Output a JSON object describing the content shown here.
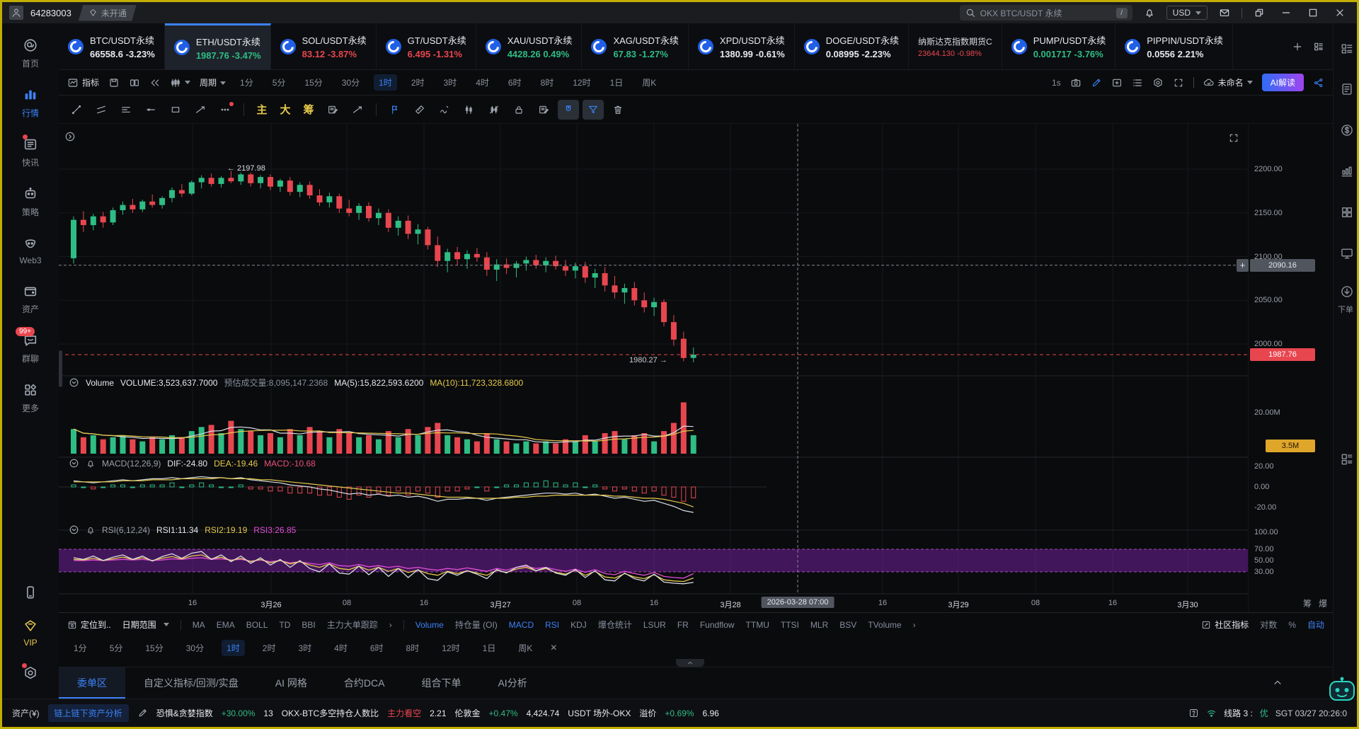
{
  "colors": {
    "up": "#2ebd85",
    "down": "#e8464f",
    "accent": "#3b82f6",
    "yellow": "#e6c94c",
    "magenta": "#e24fd8",
    "white": "#e6e9ef",
    "grey": "#848e9c",
    "orange": "#e0a62a"
  },
  "window": {
    "user_id": "64283003",
    "badge": "未开通",
    "search_placeholder": "OKX BTC/USDT 永续",
    "search_key": "/",
    "currency": "USD"
  },
  "tickers": [
    {
      "sym": "BTC/USDT永续",
      "price": "66558.6",
      "change": "-3.23%",
      "trend": "white"
    },
    {
      "sym": "ETH/USDT永续",
      "price": "1987.76",
      "change": "-3.47%",
      "trend": "green",
      "active": true
    },
    {
      "sym": "SOL/USDT永续",
      "price": "83.12",
      "change": "-3.87%",
      "trend": "red"
    },
    {
      "sym": "GT/USDT永续",
      "price": "6.495",
      "change": "-1.31%",
      "trend": "red"
    },
    {
      "sym": "XAU/USDT永续",
      "price": "4428.26",
      "change": "0.49%",
      "trend": "green"
    },
    {
      "sym": "XAG/USDT永续",
      "price": "67.83",
      "change": "-1.27%",
      "trend": "green"
    },
    {
      "sym": "XPD/USDT永续",
      "price": "1380.99",
      "change": "-0.61%",
      "trend": "white"
    },
    {
      "sym": "DOGE/USDT永续",
      "price": "0.08995",
      "change": "-2.23%",
      "trend": "white"
    },
    {
      "sym": "纳斯达克指数期货C",
      "price": "23644.130",
      "change": "-0.98%",
      "trend": "red",
      "small": true
    },
    {
      "sym": "PUMP/USDT永续",
      "price": "0.001717",
      "change": "-3.76%",
      "trend": "green"
    },
    {
      "sym": "PIPPIN/USDT永续",
      "price": "0.0556",
      "change": "2.21%",
      "trend": "white"
    }
  ],
  "periods": [
    "1分",
    "5分",
    "15分",
    "30分",
    "1时",
    "2时",
    "3时",
    "4时",
    "6时",
    "8时",
    "12时",
    "1日",
    "周K"
  ],
  "toolbar": {
    "indicator_label": "指标",
    "period_label": "周期",
    "active_period": "1时",
    "timer": "1s",
    "layout_name": "未命名",
    "ai_button": "AI解读"
  },
  "draw_toolbar": {
    "glyphs": [
      "主",
      "大",
      "筹"
    ]
  },
  "sidebar": {
    "items": [
      {
        "label": "首页",
        "icon": "home"
      },
      {
        "label": "行情",
        "icon": "bars",
        "active": true
      },
      {
        "label": "快讯",
        "icon": "news",
        "dot": true
      },
      {
        "label": "策略",
        "icon": "robot-head"
      },
      {
        "label": "Web3",
        "icon": "web3"
      },
      {
        "label": "资产",
        "icon": "wallet"
      },
      {
        "label": "群聊",
        "icon": "chat",
        "badge": "99+"
      },
      {
        "label": "更多",
        "icon": "more-grid"
      },
      {
        "label": "",
        "icon": "phone",
        "group": "bottom"
      },
      {
        "label": "VIP",
        "icon": "vip",
        "vip": true,
        "group": "bottom"
      },
      {
        "label": "",
        "icon": "gear-hex",
        "dot": true,
        "group": "bottom"
      }
    ]
  },
  "right_rail": {
    "order_label": "下单"
  },
  "chart": {
    "legend_volume": [
      {
        "t": "Volume",
        "c": "#e6e9ef"
      },
      {
        "t": "VOLUME:3,523,637.7000",
        "c": "#e6e9ef"
      },
      {
        "t": "预估成交量:8,095,147.2368",
        "c": "#848e9c"
      },
      {
        "t": "MA(5):15,822,593.6200",
        "c": "#e6e9ef"
      },
      {
        "t": "MA(10):11,723,328.6800",
        "c": "#e6c94c"
      }
    ],
    "legend_macd": [
      {
        "t": "MACD(12,26,9)",
        "c": "#9aa0aa"
      },
      {
        "t": "DIF:-24.80",
        "c": "#e6e9ef"
      },
      {
        "t": "DEA:-19.46",
        "c": "#e6c94c"
      },
      {
        "t": "MACD:-10.68",
        "c": "#e8507a"
      }
    ],
    "legend_rsi": [
      {
        "t": "RSI(6,12,24)",
        "c": "#9aa0aa"
      },
      {
        "t": "RSI1:11.34",
        "c": "#e6e9ef"
      },
      {
        "t": "RSI2:19.19",
        "c": "#e6c94c"
      },
      {
        "t": "RSI3:26.85",
        "c": "#e24fd8"
      }
    ],
    "annotations": {
      "high": "← 2197.98",
      "low": "1980.27",
      "last_price": "1987.76",
      "crosshair_price": "2090.16",
      "crosshair_time": "2026-03-28 07:00"
    },
    "y_axis_price": [
      "2200.00",
      "2150.00",
      "2100.00",
      "2050.00",
      "2000.00"
    ],
    "y_axis_volume": "20.00M",
    "volume_badge": "3.5M",
    "y_axis_macd": [
      "20.00",
      "0.00",
      "-20.00"
    ],
    "y_axis_rsi": [
      "100.00",
      "70.00",
      "50.00",
      "30.00"
    ],
    "x_axis": [
      "16",
      "3月26",
      "08",
      "16",
      "3月27",
      "08",
      "16",
      "3月28",
      "16",
      "3月29",
      "08",
      "16",
      "3月30"
    ],
    "axis_chars": [
      "筹",
      "爆"
    ]
  },
  "chart_data": {
    "type": "candlestick",
    "symbol": "ETH/USDT永续",
    "interval": "1时",
    "price_ticks": [
      2200,
      2150,
      2100,
      2050,
      2000
    ],
    "price_range": [
      1975,
      2248
    ],
    "candles": [
      [
        2098,
        2146,
        2092,
        2142
      ],
      [
        2142,
        2152,
        2128,
        2136
      ],
      [
        2136,
        2149,
        2130,
        2146
      ],
      [
        2146,
        2151,
        2133,
        2139
      ],
      [
        2139,
        2156,
        2136,
        2153
      ],
      [
        2153,
        2163,
        2148,
        2159
      ],
      [
        2159,
        2166,
        2150,
        2154
      ],
      [
        2154,
        2165,
        2151,
        2163
      ],
      [
        2163,
        2171,
        2156,
        2159
      ],
      [
        2159,
        2169,
        2155,
        2167
      ],
      [
        2167,
        2179,
        2162,
        2176
      ],
      [
        2176,
        2183,
        2168,
        2172
      ],
      [
        2172,
        2187,
        2170,
        2185
      ],
      [
        2185,
        2193,
        2178,
        2190
      ],
      [
        2190,
        2195,
        2180,
        2183
      ],
      [
        2183,
        2192,
        2179,
        2190
      ],
      [
        2190,
        2197.98,
        2184,
        2186
      ],
      [
        2186,
        2196,
        2182,
        2194
      ],
      [
        2194,
        2196,
        2180,
        2184
      ],
      [
        2184,
        2193,
        2178,
        2191
      ],
      [
        2191,
        2194,
        2176,
        2180
      ],
      [
        2180,
        2189,
        2174,
        2187
      ],
      [
        2187,
        2191,
        2170,
        2174
      ],
      [
        2174,
        2185,
        2168,
        2182
      ],
      [
        2182,
        2186,
        2166,
        2170
      ],
      [
        2170,
        2177,
        2158,
        2162
      ],
      [
        2162,
        2173,
        2156,
        2169
      ],
      [
        2169,
        2172,
        2150,
        2155
      ],
      [
        2155,
        2165,
        2146,
        2150
      ],
      [
        2150,
        2161,
        2142,
        2158
      ],
      [
        2158,
        2162,
        2140,
        2144
      ],
      [
        2144,
        2155,
        2136,
        2150
      ],
      [
        2150,
        2154,
        2128,
        2133
      ],
      [
        2133,
        2146,
        2124,
        2141
      ],
      [
        2141,
        2147,
        2120,
        2126
      ],
      [
        2126,
        2137,
        2114,
        2131
      ],
      [
        2131,
        2134,
        2108,
        2113
      ],
      [
        2113,
        2123,
        2088,
        2095
      ],
      [
        2095,
        2109,
        2082,
        2105
      ],
      [
        2105,
        2111,
        2090,
        2097
      ],
      [
        2097,
        2107,
        2086,
        2103
      ],
      [
        2103,
        2110,
        2094,
        2099
      ],
      [
        2099,
        2105,
        2078,
        2085
      ],
      [
        2085,
        2097,
        2072,
        2091
      ],
      [
        2091,
        2098,
        2080,
        2087
      ],
      [
        2087,
        2095,
        2076,
        2092
      ],
      [
        2092,
        2100,
        2084,
        2096
      ],
      [
        2096,
        2102,
        2086,
        2090
      ],
      [
        2090,
        2099,
        2082,
        2095
      ],
      [
        2095,
        2101,
        2085,
        2089
      ],
      [
        2089,
        2096,
        2078,
        2084
      ],
      [
        2084,
        2093,
        2075,
        2089
      ],
      [
        2089,
        2094,
        2070,
        2076
      ],
      [
        2076,
        2086,
        2064,
        2081
      ],
      [
        2081,
        2088,
        2060,
        2067
      ],
      [
        2067,
        2078,
        2052,
        2059
      ],
      [
        2059,
        2069,
        2046,
        2064
      ],
      [
        2064,
        2071,
        2044,
        2050
      ],
      [
        2050,
        2059,
        2036,
        2042
      ],
      [
        2042,
        2053,
        2032,
        2048
      ],
      [
        2048,
        2051,
        2020,
        2025
      ],
      [
        2025,
        2033,
        1998,
        2005
      ],
      [
        2006,
        2014,
        1980.27,
        1984
      ],
      [
        1984,
        1996,
        1979,
        1987.76
      ]
    ],
    "volumes_m": [
      12,
      8,
      9,
      7,
      8,
      9,
      7,
      6,
      8,
      7,
      9,
      8,
      11,
      13,
      14,
      10,
      16,
      12,
      11,
      9,
      10,
      8,
      12,
      9,
      13,
      11,
      8,
      12,
      10,
      8,
      9,
      7,
      11,
      8,
      12,
      9,
      13,
      15,
      9,
      8,
      7,
      6,
      10,
      7,
      6,
      5,
      6,
      5,
      6,
      5,
      7,
      6,
      9,
      6,
      10,
      11,
      7,
      9,
      10,
      6,
      11,
      15,
      25,
      9
    ],
    "macd": {
      "dif": [
        6,
        5,
        4,
        5,
        6,
        7,
        6,
        7,
        8,
        8,
        9,
        8,
        9,
        10,
        9,
        9,
        8,
        9,
        7,
        6,
        5,
        4,
        2,
        1,
        0,
        -2,
        -3,
        -5,
        -7,
        -6,
        -8,
        -7,
        -9,
        -8,
        -10,
        -9,
        -11,
        -14,
        -12,
        -12,
        -11,
        -11,
        -13,
        -11,
        -10,
        -9,
        -8,
        -7,
        -6,
        -6,
        -7,
        -6,
        -8,
        -7,
        -9,
        -11,
        -10,
        -12,
        -14,
        -13,
        -16,
        -19,
        -23,
        -24.8
      ],
      "dea": [
        5,
        5,
        5,
        5,
        5,
        6,
        6,
        6,
        7,
        7,
        7,
        8,
        8,
        8,
        8,
        9,
        8,
        8,
        8,
        7,
        7,
        6,
        5,
        4,
        3,
        2,
        1,
        0,
        -1,
        -2,
        -3,
        -4,
        -5,
        -6,
        -6,
        -7,
        -8,
        -9,
        -10,
        -10,
        -10,
        -11,
        -11,
        -11,
        -11,
        -10,
        -10,
        -9,
        -9,
        -8,
        -8,
        -8,
        -8,
        -8,
        -8,
        -9,
        -9,
        -10,
        -11,
        -11,
        -12,
        -14,
        -16,
        -19.46
      ]
    },
    "rsi": {
      "rsi1": [
        55,
        52,
        58,
        50,
        56,
        60,
        52,
        58,
        49,
        57,
        62,
        54,
        63,
        66,
        52,
        60,
        48,
        58,
        45,
        55,
        42,
        52,
        38,
        50,
        36,
        30,
        44,
        28,
        26,
        40,
        25,
        38,
        22,
        36,
        20,
        34,
        18,
        15,
        30,
        24,
        32,
        26,
        18,
        34,
        28,
        38,
        42,
        32,
        38,
        28,
        24,
        34,
        20,
        32,
        16,
        14,
        28,
        18,
        14,
        26,
        12,
        10,
        9,
        11.34
      ],
      "rsi2": [
        52,
        51,
        54,
        50,
        53,
        56,
        52,
        55,
        50,
        54,
        57,
        53,
        58,
        60,
        53,
        56,
        50,
        54,
        48,
        52,
        46,
        50,
        44,
        48,
        42,
        38,
        44,
        36,
        34,
        40,
        33,
        38,
        31,
        36,
        29,
        33,
        27,
        24,
        31,
        27,
        32,
        28,
        24,
        33,
        29,
        35,
        38,
        32,
        36,
        29,
        26,
        33,
        24,
        31,
        21,
        19,
        27,
        21,
        18,
        25,
        16,
        14,
        13,
        19.19
      ],
      "rsi3": [
        50,
        50,
        51,
        50,
        51,
        52,
        51,
        52,
        50,
        51,
        53,
        52,
        54,
        55,
        52,
        53,
        51,
        52,
        49,
        51,
        48,
        50,
        46,
        48,
        45,
        43,
        46,
        41,
        40,
        43,
        39,
        41,
        38,
        40,
        36,
        38,
        35,
        33,
        36,
        34,
        37,
        34,
        31,
        36,
        33,
        38,
        40,
        36,
        38,
        34,
        31,
        35,
        29,
        34,
        27,
        25,
        31,
        27,
        24,
        29,
        22,
        20,
        19,
        26.85
      ]
    },
    "rsi_band": [
      30,
      70
    ],
    "crosshair": {
      "time": "2026-03-28 07:00",
      "price": 2090.16
    },
    "last_price": 1987.76,
    "high_marker": 2197.98,
    "low_marker": 1980.27
  },
  "bottom": {
    "row1": [
      {
        "t": "定位到..",
        "c": "white",
        "icon": "goto"
      },
      {
        "t": "日期范围",
        "c": "white",
        "caret": true
      },
      {
        "sep": true
      },
      {
        "t": "MA"
      },
      {
        "t": "EMA"
      },
      {
        "t": "BOLL"
      },
      {
        "t": "TD"
      },
      {
        "t": "BBI"
      },
      {
        "t": "主力大单跟踪"
      },
      {
        "t": "›"
      },
      {
        "sep": true
      },
      {
        "t": "Volume",
        "c": "blue"
      },
      {
        "t": "持仓量 (OI)"
      },
      {
        "t": "MACD",
        "c": "blue"
      },
      {
        "t": "RSI",
        "c": "blue"
      },
      {
        "t": "KDJ"
      },
      {
        "t": "爆仓统计"
      },
      {
        "t": "LSUR"
      },
      {
        "t": "FR"
      },
      {
        "t": "Fundflow"
      },
      {
        "t": "TTMU"
      },
      {
        "t": "TTSI"
      },
      {
        "t": "MLR"
      },
      {
        "t": "BSV"
      },
      {
        "t": "TVolume"
      },
      {
        "t": "›"
      },
      {
        "t": "社区指标",
        "c": "white",
        "icon": "community",
        "push": true
      },
      {
        "t": "对数"
      },
      {
        "t": "%"
      },
      {
        "t": "自动",
        "c": "blue"
      }
    ],
    "row2_close": "✕",
    "tabs": [
      "委单区",
      "自定义指标/回测/实盘",
      "AI 网格",
      "合约DCA",
      "组合下单",
      "AI分析"
    ],
    "active_tab": "委单区"
  },
  "status_bar": {
    "left": [
      {
        "t": "资产(¥)"
      },
      {
        "t": "链上链下资产分析",
        "style": "linkbox"
      },
      {
        "icon": "pencil"
      },
      {
        "t": "恐惧&贪婪指数",
        "style": "white"
      },
      {
        "t": "+30.00%",
        "style": "green"
      },
      {
        "t": "13",
        "style": "white"
      },
      {
        "t": "OKX-BTC多空持仓人数比",
        "style": "white"
      },
      {
        "t": "主力看空",
        "style": "red"
      },
      {
        "t": "2.21",
        "style": "white"
      },
      {
        "t": "伦敦金",
        "style": "white"
      },
      {
        "t": "+0.47%",
        "style": "green"
      },
      {
        "t": "4,424.74",
        "style": "white"
      },
      {
        "t": "USDT 场外-OKX",
        "style": "white"
      },
      {
        "t": "溢价",
        "style": "white"
      },
      {
        "t": "+0.69%",
        "style": "green"
      },
      {
        "t": "6.96",
        "style": "white"
      }
    ],
    "right": [
      {
        "icon": "question"
      },
      {
        "icon": "wifi",
        "style": "green"
      },
      {
        "t": "线路 3 :",
        "style": "white"
      },
      {
        "t": "优",
        "style": "green"
      },
      {
        "t": "SGT 03/27 20:26:0"
      }
    ]
  }
}
